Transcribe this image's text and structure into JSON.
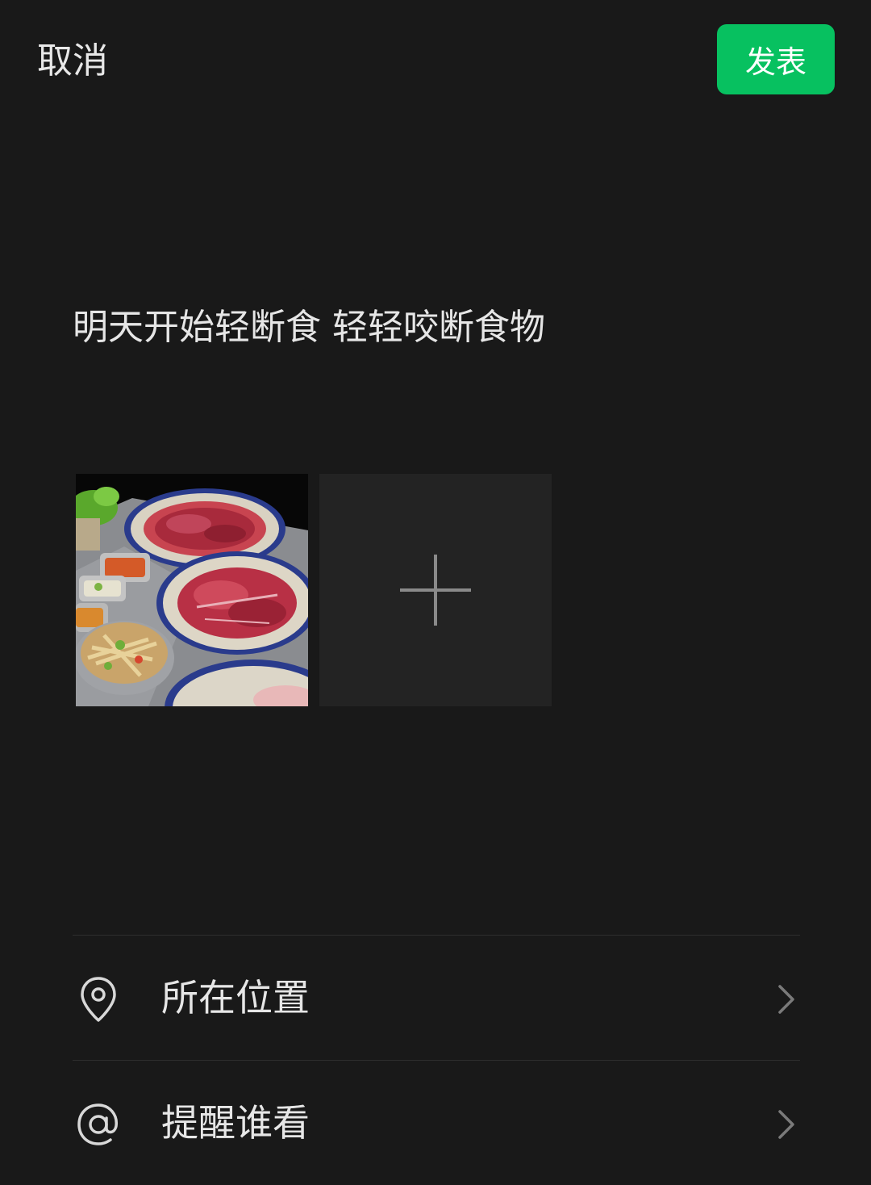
{
  "header": {
    "cancel_label": "取消",
    "publish_label": "发表",
    "accent_color": "#07c160"
  },
  "post": {
    "text": "明天开始轻断食 轻轻咬断食物"
  },
  "media": {
    "photo_icon": "food-photo",
    "add_icon": "plus-icon"
  },
  "options": [
    {
      "label": "所在位置",
      "icon": "location-pin-icon"
    },
    {
      "label": "提醒谁看",
      "icon": "at-sign-icon"
    }
  ]
}
